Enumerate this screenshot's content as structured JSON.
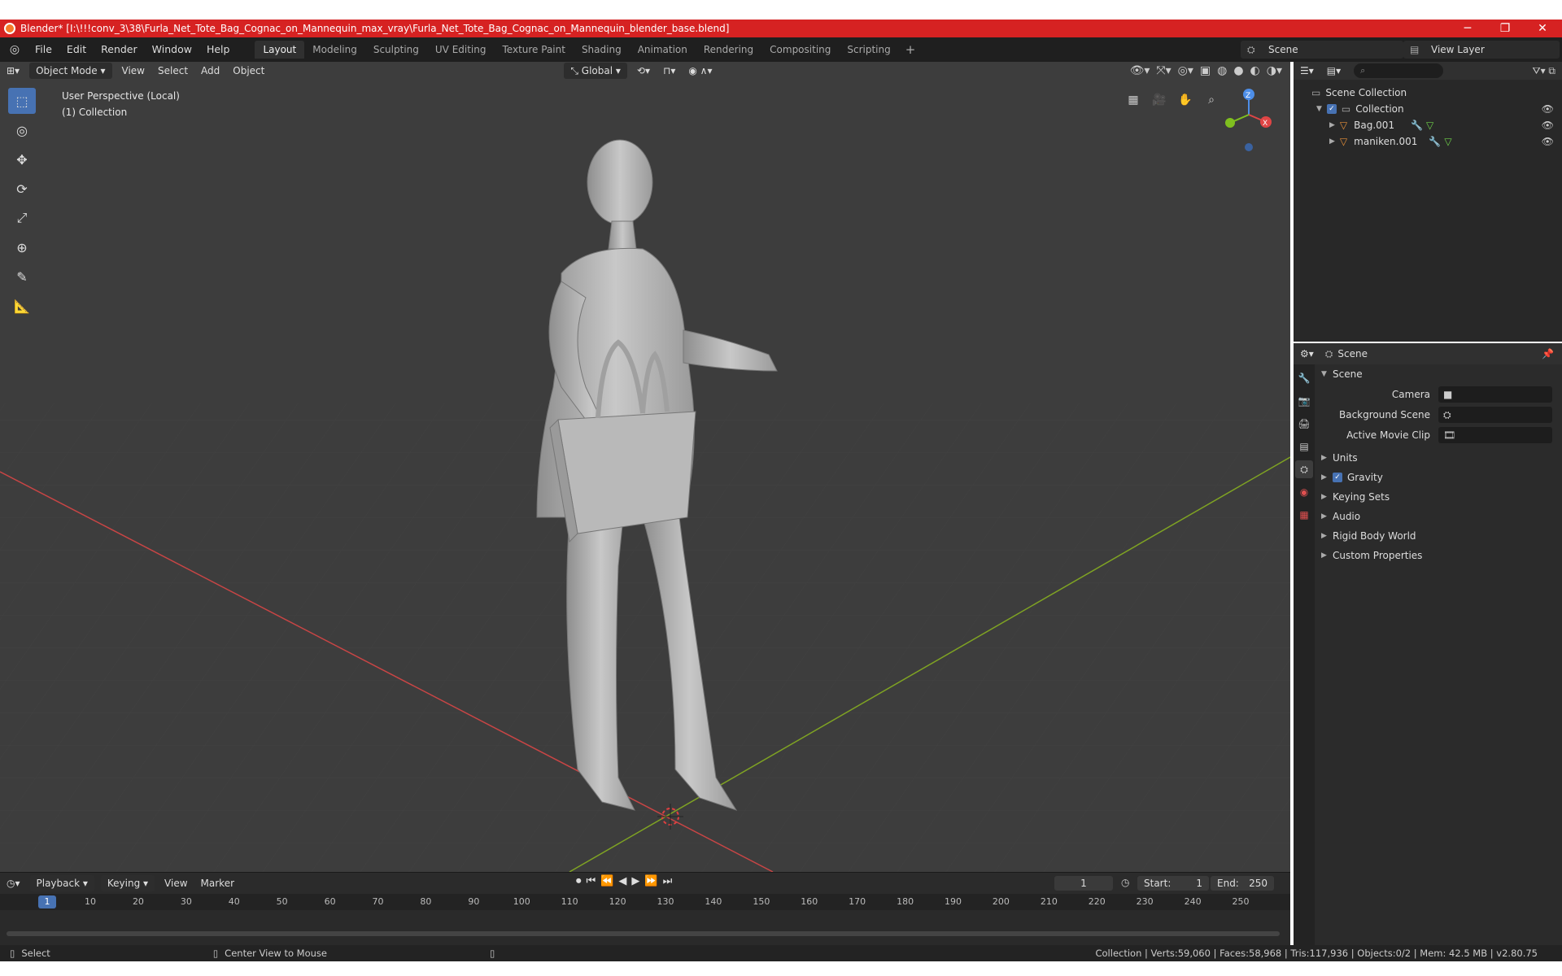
{
  "window": {
    "title": "Blender* [I:\\!!!conv_3\\38\\Furla_Net_Tote_Bag_Cognac_on_Mannequin_max_vray\\Furla_Net_Tote_Bag_Cognac_on_Mannequin_blender_base.blend]",
    "minimize": "─",
    "maximize": "❐",
    "close": "✕"
  },
  "menubar": {
    "items": [
      "File",
      "Edit",
      "Render",
      "Window",
      "Help"
    ],
    "workspaces": [
      "Layout",
      "Modeling",
      "Sculpting",
      "UV Editing",
      "Texture Paint",
      "Shading",
      "Animation",
      "Rendering",
      "Compositing",
      "Scripting"
    ],
    "active_workspace": "Layout",
    "add": "+",
    "scene": "Scene",
    "view_layer": "View Layer"
  },
  "viewport": {
    "mode": "Object Mode",
    "menu": [
      "View",
      "Select",
      "Add",
      "Object"
    ],
    "orientation": "Global",
    "perspective": "User Perspective (Local)",
    "collection": "(1) Collection",
    "gizmo_z": "Z",
    "gizmo_x": "X"
  },
  "timeline": {
    "menus": [
      "Playback",
      "Keying",
      "View",
      "Marker"
    ],
    "current_frame": "1",
    "start_label": "Start:",
    "start": "1",
    "end_label": "End:",
    "end": "250",
    "ticks": [
      "1",
      "10",
      "20",
      "30",
      "40",
      "50",
      "60",
      "70",
      "80",
      "90",
      "100",
      "110",
      "120",
      "130",
      "140",
      "150",
      "160",
      "170",
      "180",
      "190",
      "200",
      "210",
      "220",
      "230",
      "240",
      "250"
    ]
  },
  "statusbar": {
    "left": "Select",
    "middle": "Center View to Mouse",
    "right": "Collection | Verts:59,060 | Faces:58,968 | Tris:117,936 | Objects:0/2 | Mem: 42.5 MB | v2.80.75"
  },
  "outliner": {
    "root": "Scene Collection",
    "collection": "Collection",
    "objects": [
      "Bag.001",
      "maniken.001"
    ]
  },
  "properties": {
    "header": "Scene",
    "section": "Scene",
    "fields": [
      {
        "label": "Camera"
      },
      {
        "label": "Background Scene"
      },
      {
        "label": "Active Movie Clip"
      }
    ],
    "subsections": [
      "Units",
      "Gravity",
      "Keying Sets",
      "Audio",
      "Rigid Body World",
      "Custom Properties"
    ]
  },
  "colors": {
    "titlebar": "#d62222",
    "accent": "#4772b3",
    "viewport_bg": "#3d3d3d",
    "x_axis": "#c84545",
    "y_axis": "#7fa323"
  }
}
